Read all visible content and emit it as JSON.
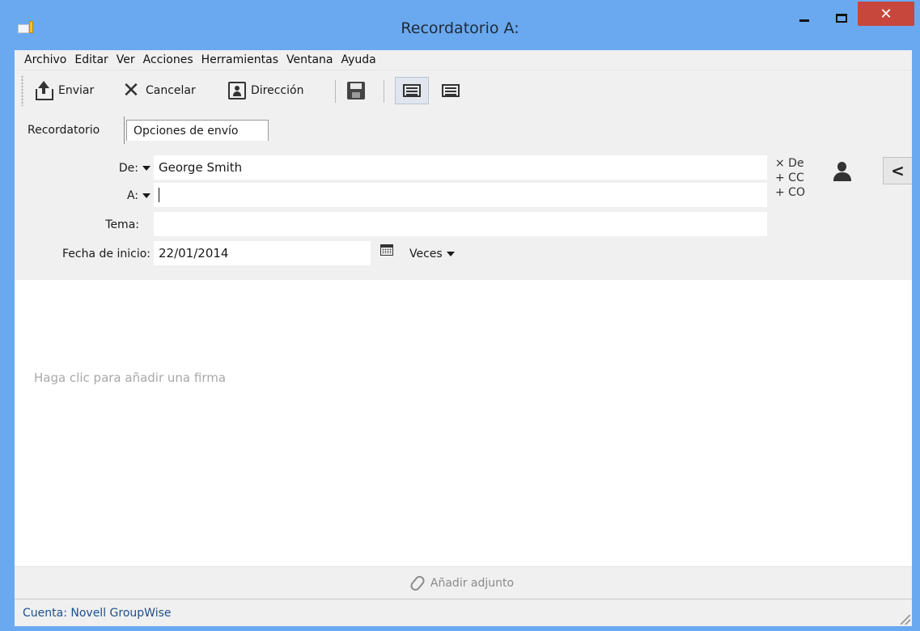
{
  "window": {
    "title": "Recordatorio A:",
    "close_glyph": "✕"
  },
  "menu": [
    "Archivo",
    "Editar",
    "Ver",
    "Acciones",
    "Herramientas",
    "Ventana",
    "Ayuda"
  ],
  "toolbar": {
    "send_label": "Enviar",
    "cancel_label": "Cancelar",
    "address_label": "Dirección",
    "cancel_glyph": "✕"
  },
  "tabs": {
    "active": "Recordatorio",
    "inactive": "Opciones de envío"
  },
  "form": {
    "from_label": "De:",
    "from_value": "George Smith",
    "to_label": "A:",
    "to_value": "",
    "subject_label": "Tema:",
    "subject_value": "",
    "start_date_label": "Fecha de inicio:",
    "start_date_value": "22/01/2014",
    "times_label": "Veces"
  },
  "side_links": {
    "from": "× De",
    "cc": "+ CC",
    "bcc": "+ CO",
    "collapse_glyph": "<"
  },
  "body": {
    "signature_placeholder": "Haga clic para añadir una firma"
  },
  "attach": {
    "label": "Añadir adjunto"
  },
  "status": {
    "account": "Cuenta: Novell GroupWise"
  },
  "colors": {
    "title_bar": "#6aa9ef",
    "close_button": "#c7473c",
    "panel_bg": "#f0f0f0",
    "status_text": "#1e4f8a"
  }
}
